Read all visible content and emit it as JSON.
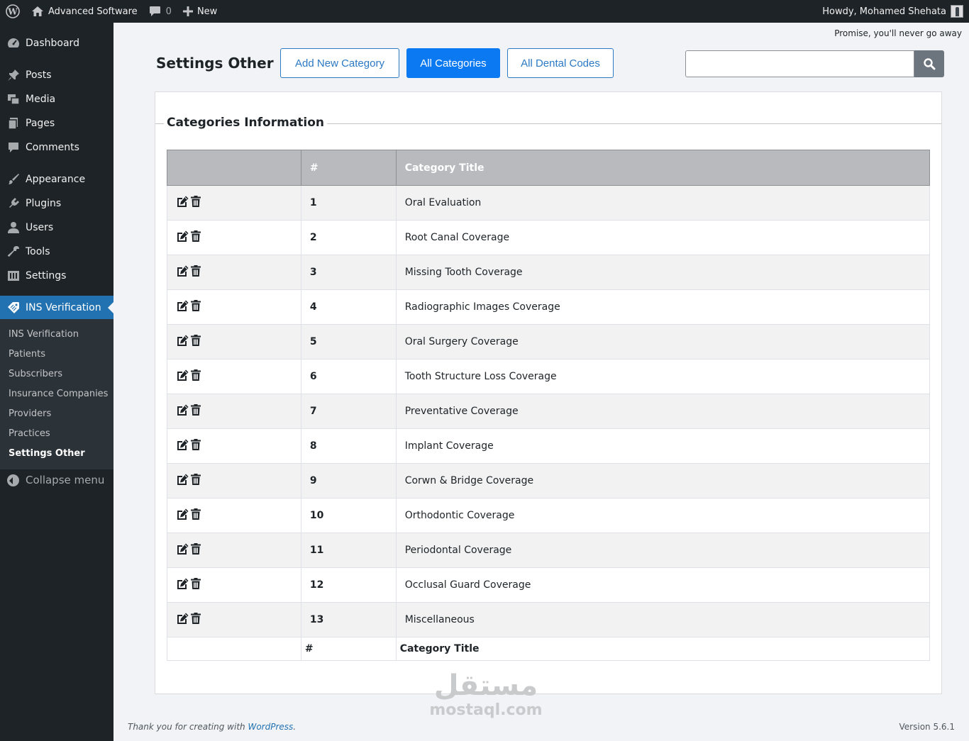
{
  "adminbar": {
    "site_name": "Advanced Software",
    "comments_count": "0",
    "new_label": "New",
    "howdy": "Howdy, Mohamed Shehata"
  },
  "sidebar": {
    "items": [
      {
        "label": "Dashboard",
        "icon": "dashboard-icon"
      },
      {
        "label": "Posts",
        "icon": "pin-icon"
      },
      {
        "label": "Media",
        "icon": "media-icon"
      },
      {
        "label": "Pages",
        "icon": "pages-icon"
      },
      {
        "label": "Comments",
        "icon": "comment-icon"
      },
      {
        "label": "Appearance",
        "icon": "brush-icon"
      },
      {
        "label": "Plugins",
        "icon": "plugin-icon"
      },
      {
        "label": "Users",
        "icon": "user-icon"
      },
      {
        "label": "Tools",
        "icon": "wrench-icon"
      },
      {
        "label": "Settings",
        "icon": "settings-icon"
      },
      {
        "label": "INS Verification",
        "icon": "tag-icon"
      }
    ],
    "submenu": [
      "INS Verification",
      "Patients",
      "Subscribers",
      "Insurance Companies",
      "Providers",
      "Practices",
      "Settings Other"
    ],
    "collapse_label": "Collapse menu"
  },
  "header": {
    "promise": "Promise, you'll never go away",
    "title": "Settings Other",
    "buttons": [
      "Add New Category",
      "All Categories",
      "All Dental Codes"
    ]
  },
  "card": {
    "title": "Categories Information",
    "columns": [
      "",
      "#",
      "Category Title"
    ],
    "rows": [
      {
        "id": "1",
        "title": "Oral Evaluation"
      },
      {
        "id": "2",
        "title": "Root Canal Coverage"
      },
      {
        "id": "3",
        "title": "Missing Tooth Coverage"
      },
      {
        "id": "4",
        "title": "Radiographic Images Coverage"
      },
      {
        "id": "5",
        "title": "Oral Surgery Coverage"
      },
      {
        "id": "6",
        "title": "Tooth Structure Loss Coverage"
      },
      {
        "id": "7",
        "title": "Preventative Coverage"
      },
      {
        "id": "8",
        "title": "Implant Coverage"
      },
      {
        "id": "9",
        "title": "Corwn & Bridge Coverage"
      },
      {
        "id": "10",
        "title": "Orthodontic Coverage"
      },
      {
        "id": "11",
        "title": "Periodontal Coverage"
      },
      {
        "id": "12",
        "title": "Occlusal Guard Coverage"
      },
      {
        "id": "13",
        "title": "Miscellaneous"
      }
    ],
    "footer_columns": [
      "",
      "#",
      "Category Title"
    ]
  },
  "footer": {
    "thanks": "Thank you for creating with ",
    "wp_link": "WordPress",
    "period": ".",
    "version": "Version 5.6.1"
  },
  "watermark": {
    "arabic": "مستقل",
    "latin": "mostaql.com"
  },
  "colors": {
    "adminbar_bg": "#1d2327",
    "accent": "#2271b1",
    "primary_button": "#0b79f1",
    "table_header": "#b8babe"
  }
}
